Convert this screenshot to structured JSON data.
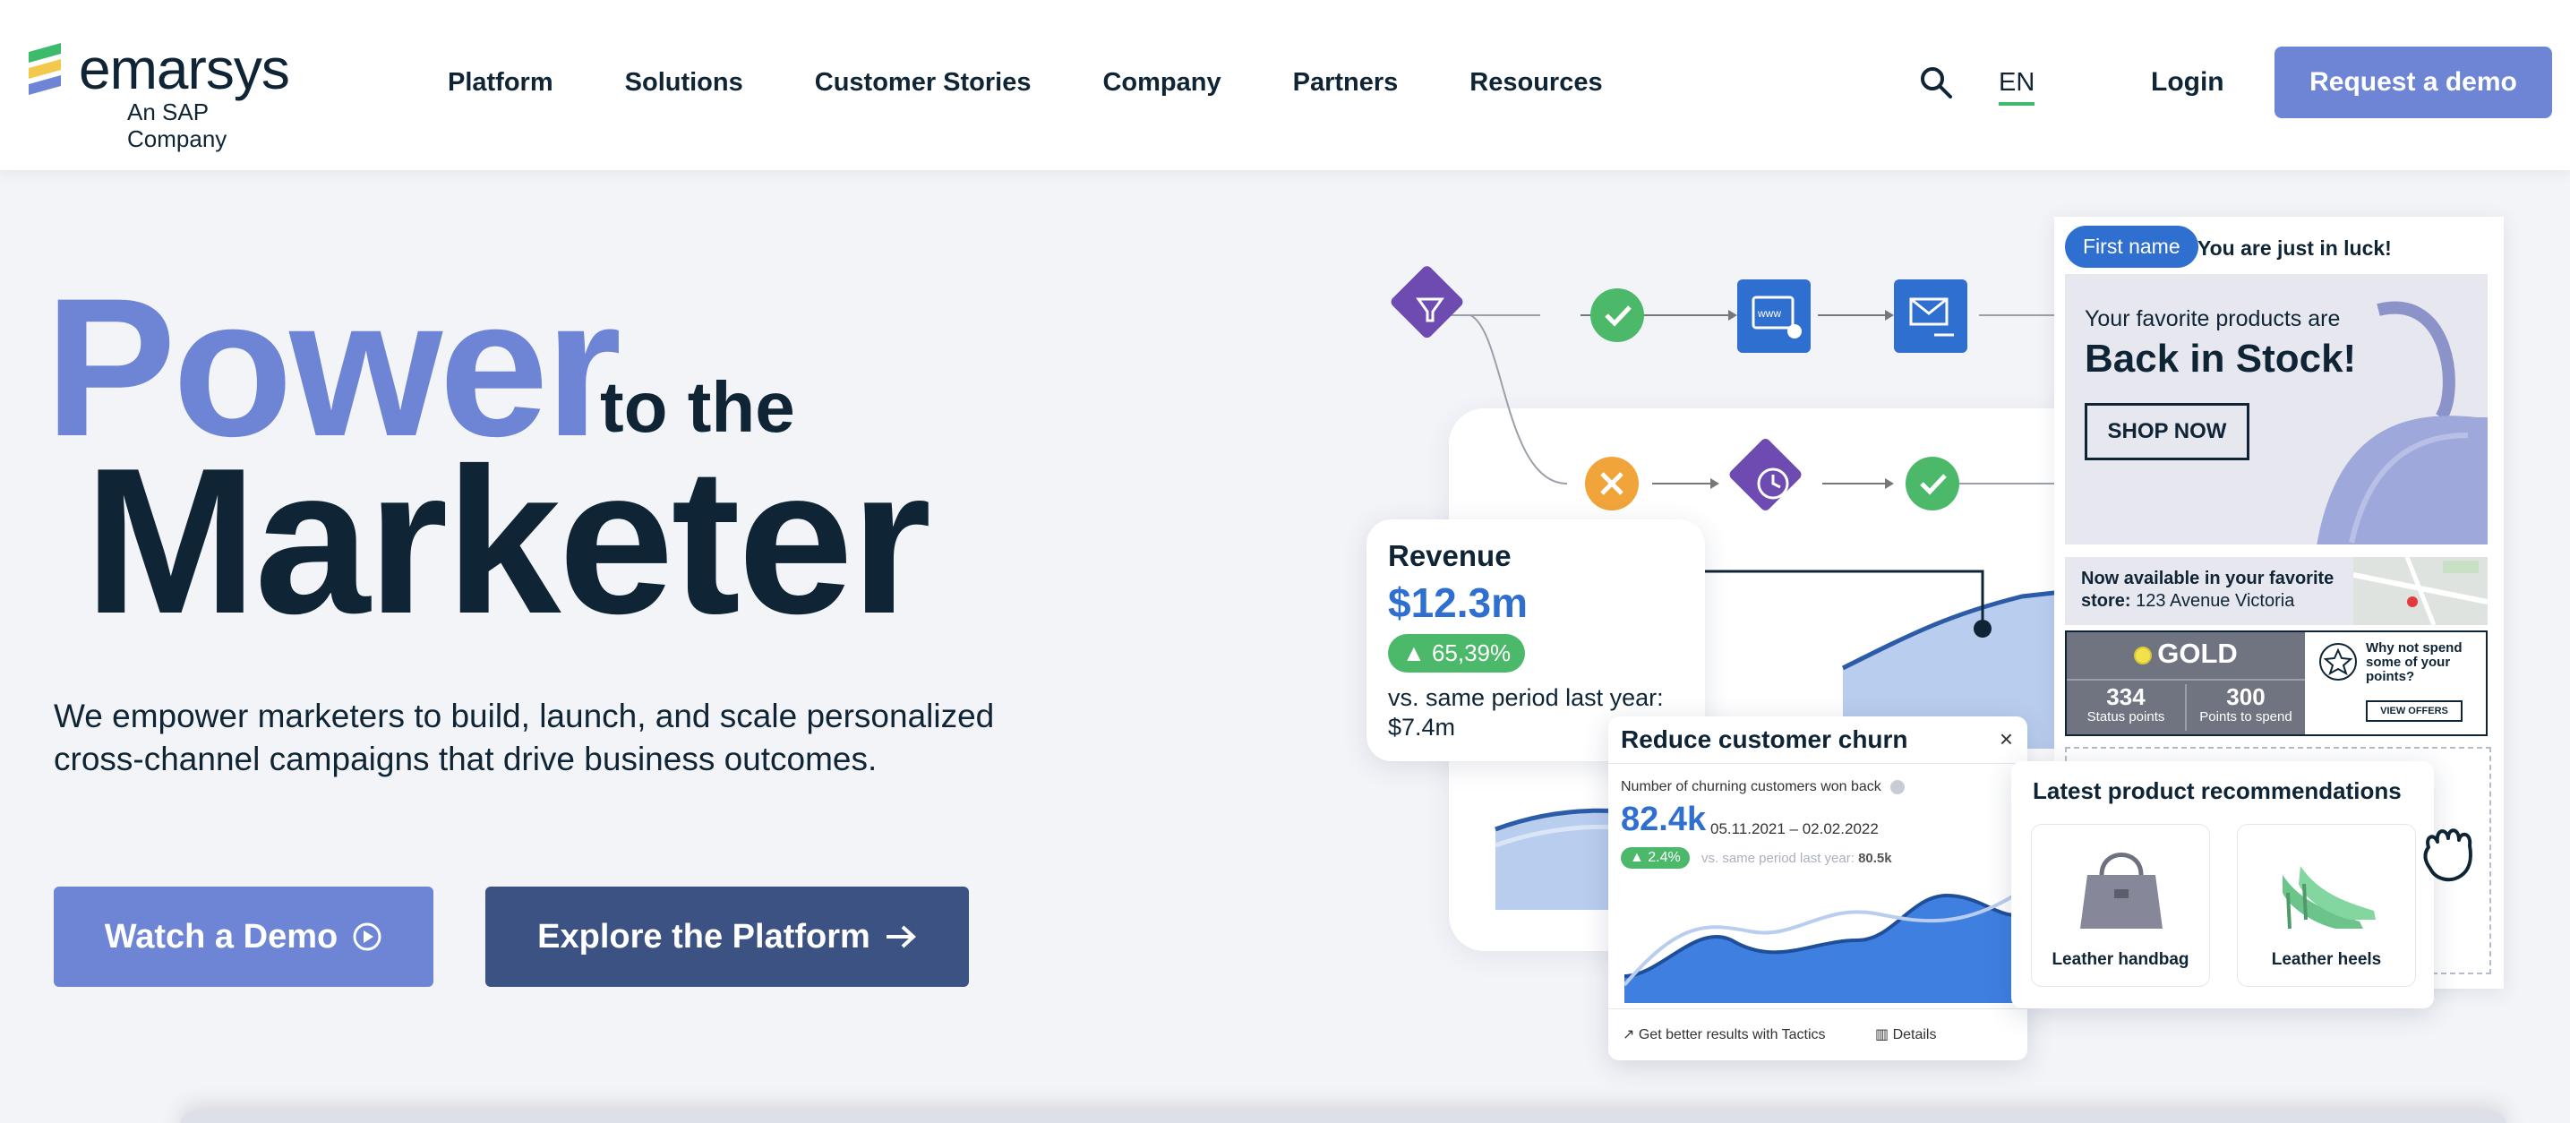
{
  "header": {
    "logo_word": "emarsys",
    "logo_sub": "An SAP Company",
    "nav": [
      "Platform",
      "Solutions",
      "Customer Stories",
      "Company",
      "Partners",
      "Resources"
    ],
    "lang": "EN",
    "login": "Login",
    "request_demo": "Request a demo"
  },
  "hero": {
    "power": "Power",
    "to_the": "to the",
    "marketer": "Marketer",
    "description": "We empower marketers to build, launch, and scale personalized cross-channel campaigns that drive business outcomes.",
    "watch_demo": "Watch a Demo",
    "explore_platform": "Explore the Platform",
    "accent_color": "#6d85d4",
    "dark_color": "#3c5283"
  },
  "revenue": {
    "title": "Revenue",
    "value": "$12.3m",
    "change": "▲ 65,39%",
    "note": "vs. same period last year: $7.4m"
  },
  "churn": {
    "title": "Reduce customer churn",
    "close": "×",
    "label": "Number of churning customers won back",
    "value": "82.4k",
    "dates": "05.11.2021 – 02.02.2022",
    "badge": "▲ 2.4%",
    "vs_prefix": "vs. same period last year:",
    "vs_value": "80.5k",
    "tactics": "Get better results with Tactics",
    "details": "Details"
  },
  "email": {
    "first_name": "First name",
    "luck": "You are just in luck!",
    "pre": "Your favorite products are",
    "back_in_stock": "Back in Stock!",
    "shop_now": "SHOP NOW",
    "store_bold": "Now available in your favorite store:",
    "store_addr": "123 Avenue Victoria",
    "gold": "GOLD",
    "status_points": "334",
    "status_label": "Status points",
    "spend_points": "300",
    "spend_label": "Points to spend",
    "why_not": "Why not spend some of your points?",
    "view_offers": "VIEW OFFERS"
  },
  "recommendations": {
    "title": "Latest product recommendations",
    "items": [
      {
        "name": "Leather handbag"
      },
      {
        "name": "Leather heels"
      }
    ]
  }
}
